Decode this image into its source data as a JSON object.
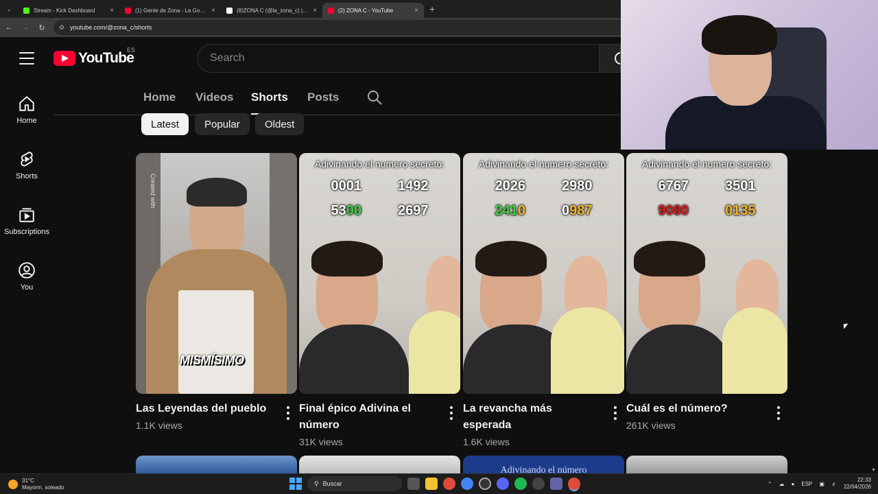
{
  "browser": {
    "tabs": [
      {
        "title": "Stream - Kick Dashboard",
        "color": "#53fc18",
        "active": false
      },
      {
        "title": "(1) Gente de Zona - La Gozadera",
        "color": "#ff0033",
        "active": false
      },
      {
        "title": "(8)ZONA C (@la_zona_c) | TikTok",
        "color": "#ffffff",
        "active": false
      },
      {
        "title": "(2) ZONA C - YouTube",
        "color": "#ff0033",
        "active": true
      }
    ],
    "close_glyph": "×",
    "new_tab_glyph": "+",
    "url": "youtube.com/@zona_c/shorts"
  },
  "masthead": {
    "logo_text": "YouTube",
    "region": "ES",
    "search_placeholder": "Search"
  },
  "guide": {
    "items": [
      {
        "label": "Home",
        "icon": "home-icon"
      },
      {
        "label": "Shorts",
        "icon": "shorts-icon"
      },
      {
        "label": "Subscriptions",
        "icon": "subscriptions-icon"
      },
      {
        "label": "You",
        "icon": "you-icon"
      }
    ]
  },
  "channel_tabs": {
    "items": [
      "Home",
      "Videos",
      "Shorts",
      "Posts"
    ],
    "selected": "Shorts"
  },
  "chips": {
    "items": [
      "Latest",
      "Popular",
      "Oldest"
    ],
    "selected": "Latest"
  },
  "shorts": [
    {
      "title": "Las Leyendas del pueblo",
      "views": "1.1K views",
      "caption": "MISMÍSIMO",
      "watermark": "Created with"
    },
    {
      "title": "Final épico Adivina el número",
      "views": "31K views",
      "banner": "Adivinando el numero secreto:",
      "row1": [
        "0001",
        "1492"
      ],
      "row2a": [
        "53",
        "00",
        ""
      ],
      "row2b": "2697"
    },
    {
      "title": "La revancha más esperada",
      "views": "1.6K views",
      "banner": "Adivinando el numero secreto:",
      "row1": [
        "2026",
        "2980"
      ],
      "row2a": [
        "241",
        "0"
      ],
      "row2b": [
        "0",
        "987"
      ]
    },
    {
      "title": "Cuál es el número?",
      "views": "261K views",
      "banner": "Adivinando el numero secreto:",
      "row1": [
        "6767",
        "3501"
      ],
      "row2a": "9080",
      "row2b": "0135"
    }
  ],
  "next_row_text": "Adivinando el número",
  "taskbar": {
    "weather_temp": "31°C",
    "weather_desc": "Mayorm. soleado",
    "search_label": "Buscar",
    "lang": "ESP",
    "time": "22:33",
    "date": "22/04/2026"
  }
}
